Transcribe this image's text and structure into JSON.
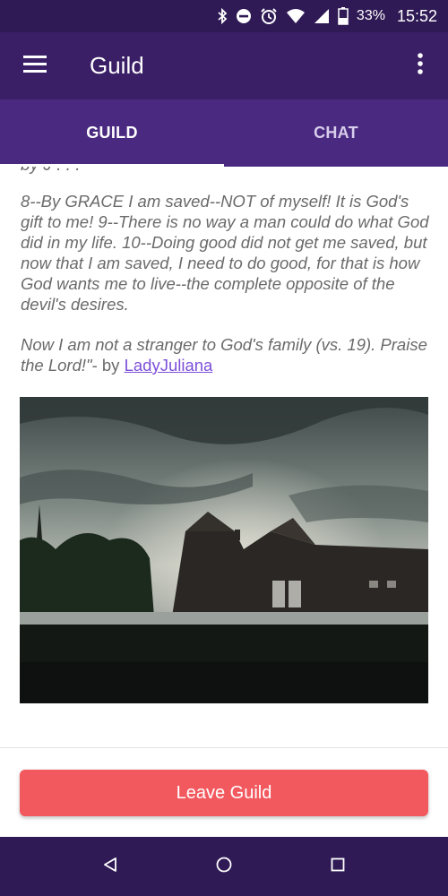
{
  "status_bar": {
    "battery_percent": "33%",
    "time": "15:52",
    "icons": [
      "bluetooth-icon",
      "do-not-disturb-icon",
      "alarm-icon",
      "wifi-icon",
      "cellular-signal-icon",
      "battery-icon"
    ]
  },
  "app_bar": {
    "title": "Guild",
    "menu_icon": "hamburger-menu-icon",
    "overflow_icon": "more-vertical-icon"
  },
  "tabs": [
    {
      "label": "GUILD",
      "active": true
    },
    {
      "label": "CHAT",
      "active": false
    }
  ],
  "post": {
    "clipped_top_line": "by J  . . .",
    "paragraph_1": "8--By GRACE I am saved--NOT of myself! It is God's gift to me! 9--There is no way a man could do what God did in my life. 10--Doing good did not get me saved, but now that I am saved, I need to do good, for that is how God wants me to live--the complete opposite of the devil's desires.",
    "paragraph_2_quote": "Now I am not a stranger to God's family (vs. 19). Praise the Lord!\"",
    "by_text": "- by",
    "author": "LadyJuliana"
  },
  "actions": {
    "leave_label": "Leave Guild"
  },
  "nav_bar": {
    "icons": [
      "back-icon",
      "home-icon",
      "recents-icon"
    ]
  },
  "colors": {
    "status_bar": "#2f1a55",
    "app_bar": "#3a1f66",
    "tab_bar": "#4a2a80",
    "leave_button": "#f2595f",
    "link": "#7d4fd9"
  }
}
